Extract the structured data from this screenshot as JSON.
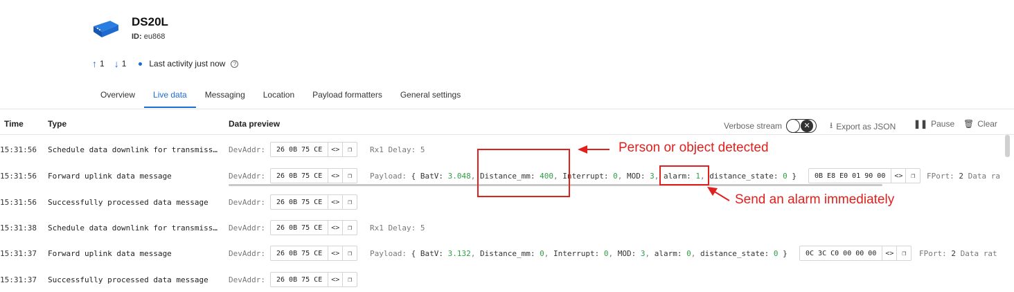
{
  "device": {
    "name": "DS20L",
    "id_label": "ID:",
    "id_value": "eu868",
    "uplink_count": "1",
    "downlink_count": "1",
    "activity": "Last activity just now"
  },
  "tabs": [
    "Overview",
    "Live data",
    "Messaging",
    "Location",
    "Payload formatters",
    "General settings"
  ],
  "active_tab": "Live data",
  "columns": {
    "time": "Time",
    "type": "Type",
    "data_preview": "Data preview"
  },
  "toolbar": {
    "verbose": "Verbose stream",
    "export": "Export as JSON",
    "pause": "Pause",
    "clear": "Clear"
  },
  "rows": [
    {
      "time": "15:31:56",
      "type": "Schedule data downlink for transmiss…",
      "devaddr_label": "DevAddr:",
      "devaddr": "26 0B 75 CE",
      "extra": "Rx1 Delay: 5"
    },
    {
      "time": "15:31:56",
      "type": "Forward uplink data message",
      "devaddr_label": "DevAddr:",
      "devaddr": "26 0B 75 CE",
      "payload": {
        "label": "Payload:",
        "BatV": "3.048",
        "Distance_mm": "400",
        "Interrupt": "0",
        "MOD": "3",
        "alarm": "1",
        "distance_state": "0"
      },
      "hex": "0B E8 E0 01 90 00",
      "fport_label": "FPort:",
      "fport": "2",
      "rate_text": "Data ra"
    },
    {
      "time": "15:31:56",
      "type": "Successfully processed data message",
      "devaddr_label": "DevAddr:",
      "devaddr": "26 0B 75 CE"
    },
    {
      "time": "15:31:38",
      "type": "Schedule data downlink for transmiss…",
      "devaddr_label": "DevAddr:",
      "devaddr": "26 0B 75 CE",
      "extra": "Rx1 Delay: 5"
    },
    {
      "time": "15:31:37",
      "type": "Forward uplink data message",
      "devaddr_label": "DevAddr:",
      "devaddr": "26 0B 75 CE",
      "payload": {
        "label": "Payload:",
        "BatV": "3.132",
        "Distance_mm": "0",
        "Interrupt": "0",
        "MOD": "3",
        "alarm": "0",
        "distance_state": "0"
      },
      "hex": "0C 3C C0 00 00 00",
      "fport_label": "FPort:",
      "fport": "2",
      "rate_text": "Data rat"
    },
    {
      "time": "15:31:37",
      "type": "Successfully processed data message",
      "devaddr_label": "DevAddr:",
      "devaddr": "26 0B 75 CE"
    }
  ],
  "annotations": {
    "detected": "Person or object detected",
    "alarm": "Send an alarm immediately"
  },
  "colors": {
    "accent": "#1a6cd6",
    "annotation": "#e0201d",
    "number": "#2f9e44"
  }
}
